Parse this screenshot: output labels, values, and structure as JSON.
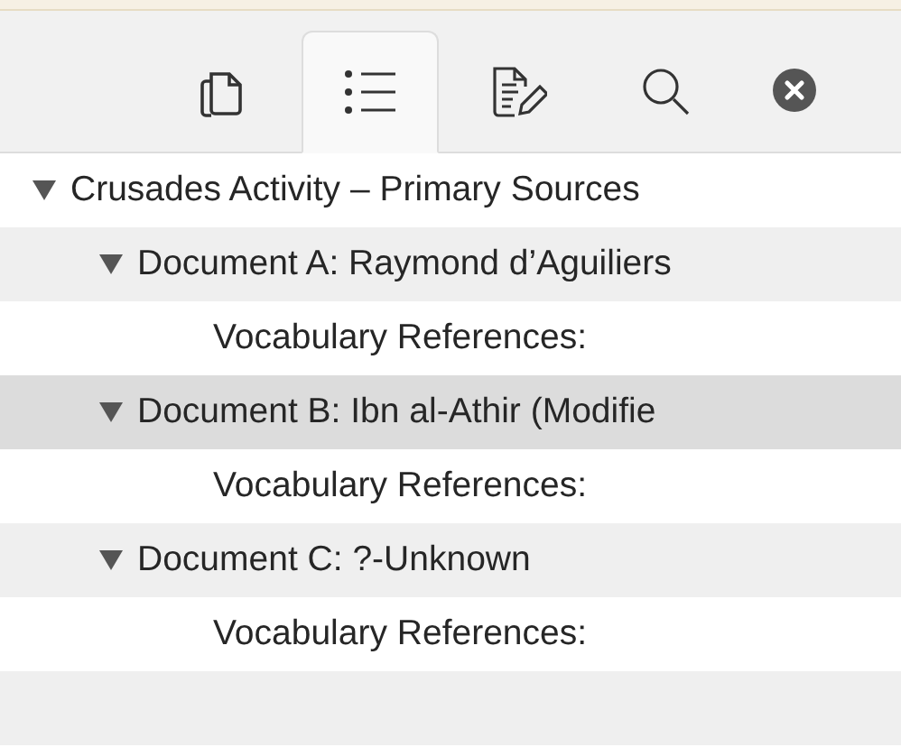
{
  "toolbar": {
    "tabs": [
      {
        "kind": "pages",
        "selected": false
      },
      {
        "kind": "outline",
        "selected": true
      },
      {
        "kind": "annotate",
        "selected": false
      },
      {
        "kind": "search",
        "selected": false
      }
    ]
  },
  "outline": [
    {
      "label": "Crusades Activity – Primary Sources",
      "expanded": true,
      "selected": false,
      "children": [
        {
          "label": "Document A: Raymond d’Aguiliers",
          "expanded": true,
          "selected": false,
          "children": [
            {
              "label": "Vocabulary References:",
              "selected": false
            }
          ]
        },
        {
          "label": "Document B: Ibn al-Athir (Modifie",
          "expanded": true,
          "selected": true,
          "children": [
            {
              "label": "Vocabulary References:",
              "selected": false
            }
          ]
        },
        {
          "label": "Document C: ?-Unknown",
          "expanded": true,
          "selected": false,
          "children": [
            {
              "label": "Vocabulary References:",
              "selected": false
            }
          ]
        }
      ]
    }
  ]
}
